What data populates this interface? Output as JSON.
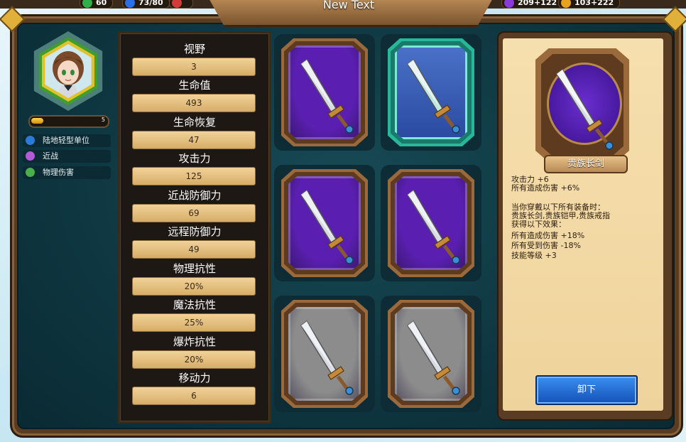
{
  "window_title": "New Text",
  "resources": [
    {
      "value": "60",
      "color": "#2fb04a"
    },
    {
      "value": "73/80",
      "color": "#2a6ee8"
    },
    {
      "value": "209+122",
      "color": "#8a3ad6"
    },
    {
      "value": "103+222",
      "color": "#e8a21e"
    }
  ],
  "hero": {
    "level": "5",
    "level_progress": 0.15,
    "tags": [
      {
        "label": "陆地轻型单位",
        "icon": "unit-type-icon",
        "color": "#2a7ad8"
      },
      {
        "label": "近战",
        "icon": "melee-icon",
        "color": "#b35ad8"
      },
      {
        "label": "物理伤害",
        "icon": "physical-damage-icon",
        "color": "#4ab04a"
      }
    ]
  },
  "stats": [
    {
      "label": "视野",
      "value": "3"
    },
    {
      "label": "生命值",
      "value": "493"
    },
    {
      "label": "生命恢复",
      "value": "47"
    },
    {
      "label": "攻击力",
      "value": "125"
    },
    {
      "label": "近战防御力",
      "value": "69"
    },
    {
      "label": "远程防御力",
      "value": "49"
    },
    {
      "label": "物理抗性",
      "value": "20%"
    },
    {
      "label": "魔法抗性",
      "value": "25%"
    },
    {
      "label": "爆炸抗性",
      "value": "20%"
    },
    {
      "label": "移动力",
      "value": "6"
    }
  ],
  "equipment": [
    {
      "rarity": "purple",
      "selected": false
    },
    {
      "rarity": "blue",
      "selected": true
    },
    {
      "rarity": "purple",
      "selected": false
    },
    {
      "rarity": "purple",
      "selected": false
    },
    {
      "rarity": "gray",
      "selected": false
    },
    {
      "rarity": "gray",
      "selected": false
    }
  ],
  "detail": {
    "item_name": "贵族长剑",
    "line1": "攻击力 +6",
    "line2": "所有造成伤害 +6%",
    "set_line1": "当你穿戴以下所有装备时：",
    "set_line2": "贵族长剑,贵族铠甲,贵族戒指",
    "set_line3": "获得以下效果：",
    "set_line4": "所有造成伤害 +18%",
    "set_line5": "所有受到伤害 -18%",
    "set_line6": "技能等级 +3",
    "unequip_label": "卸下"
  },
  "colors": {
    "purple": "#5a1fb0",
    "blue": "#2d55c0",
    "gray": "#8c8c8c"
  }
}
